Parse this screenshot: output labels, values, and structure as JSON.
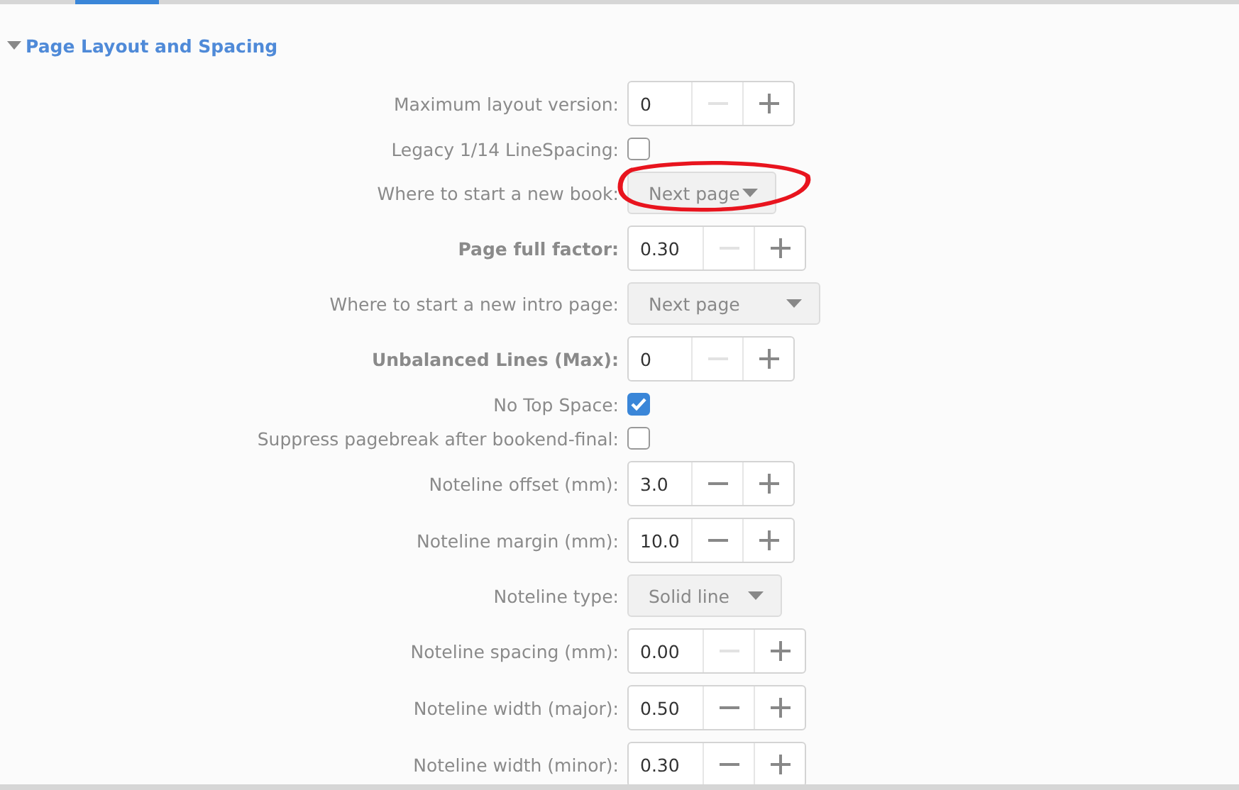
{
  "section": {
    "title": "Page Layout and Spacing",
    "expanded": true
  },
  "rows": [
    {
      "kind": "spin",
      "label": "Maximum layout version:",
      "bold": false,
      "value": "0",
      "minus_disabled": true
    },
    {
      "kind": "check",
      "label": "Legacy 1/14 LineSpacing:",
      "bold": false,
      "checked": false
    },
    {
      "kind": "dropdown",
      "label": "Where to start a new book:",
      "bold": false,
      "value": "Next page"
    },
    {
      "kind": "spin",
      "label": "Page full factor:",
      "bold": true,
      "value": "0.30",
      "minus_disabled": true
    },
    {
      "kind": "dropdown",
      "label": "Where to start a new intro page:",
      "bold": false,
      "value": "Next page"
    },
    {
      "kind": "spin",
      "label": "Unbalanced Lines (Max):",
      "bold": true,
      "value": "0",
      "minus_disabled": true
    },
    {
      "kind": "check",
      "label": "No Top Space:",
      "bold": false,
      "checked": true
    },
    {
      "kind": "check",
      "label": "Suppress pagebreak after bookend-final:",
      "bold": false,
      "checked": false
    },
    {
      "kind": "spin",
      "label": "Noteline offset (mm):",
      "bold": false,
      "value": "3.0",
      "minus_disabled": false
    },
    {
      "kind": "spin",
      "label": "Noteline margin (mm):",
      "bold": false,
      "value": "10.0",
      "minus_disabled": false
    },
    {
      "kind": "dropdown",
      "label": "Noteline type:",
      "bold": false,
      "value": "Solid line"
    },
    {
      "kind": "spin",
      "label": "Noteline spacing (mm):",
      "bold": false,
      "value": "0.00",
      "minus_disabled": true
    },
    {
      "kind": "spin",
      "label": "Noteline width (major):",
      "bold": false,
      "value": "0.50",
      "minus_disabled": false
    },
    {
      "kind": "spin",
      "label": "Noteline width (minor):",
      "bold": false,
      "value": "0.30",
      "minus_disabled": false
    }
  ],
  "annotation": {
    "kind": "ellipse",
    "color": "#e8141e"
  }
}
